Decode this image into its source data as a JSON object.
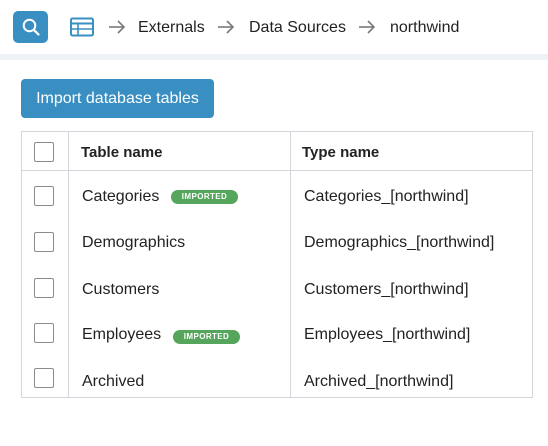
{
  "header": {
    "search_icon": "search-icon",
    "table_icon": "table-icon",
    "breadcrumb": [
      "Externals",
      "Data Sources",
      "northwind"
    ]
  },
  "toolbar": {
    "import_label": "Import database tables"
  },
  "table": {
    "columns": [
      "Table name",
      "Type name"
    ],
    "rows": [
      {
        "name": "Categories",
        "type": "Categories_[northwind]",
        "badge": "IMPORTED"
      },
      {
        "name": "Demographics",
        "type": "Demographics_[northwind]",
        "badge": null
      },
      {
        "name": "Customers",
        "type": "Customers_[northwind]",
        "badge": null
      },
      {
        "name": "Employees",
        "type": "Employees_[northwind]",
        "badge": "IMPORTED"
      },
      {
        "name": "Archived",
        "type": "Archived_[northwind]",
        "badge": null
      }
    ]
  },
  "colors": {
    "accent": "#3a8fc2",
    "badge": "#55a65c",
    "border": "#d3d7dc"
  }
}
